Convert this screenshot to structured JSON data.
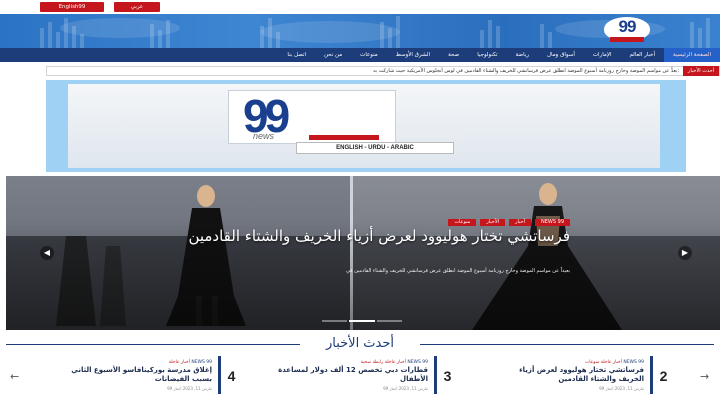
{
  "topbar": {
    "site_button": "English99",
    "lang_button": "عربي"
  },
  "brand": {
    "logo_text": "99"
  },
  "nav": {
    "items": [
      "الصفحة الرئيسية",
      "أخبار العالم",
      "الإمارات",
      "أسواق ومال",
      "رياضة",
      "تكنولوجيا",
      "صحة",
      "الشرق الأوسط",
      "منوعات",
      "من نحن",
      "اتصل بنا"
    ]
  },
  "ticker": {
    "label": "أحدث الأخبار",
    "text": "يعدُّ عن مواسم الموضة وحارج روزنامة أسبوع الموضة انطلق عرض فرساتشي للخريف والشتاء القادمين في لوس أنجلوس الأمريكية حيث شاركت به:"
  },
  "ad": {
    "logo": "99",
    "logo_sub": "news",
    "languages": "ENGLISH - URDU - ARABIC"
  },
  "hero": {
    "categories": [
      "NEWS 99",
      "أخبار",
      "الأخبار",
      "منوعات"
    ],
    "title": "فرساتشي تختار هوليوود لعرض أزياء الخريف والشتاء القادمين",
    "excerpt": "بعيداً عن مواسم الموضة وخارج روزنامة أسبوع الموضة انطلق عرض فرساتشي للخريف والشتاء القادمين في"
  },
  "latest": {
    "heading": "أحدث الأخبار",
    "items": [
      {
        "num": "2",
        "meta_source": "NEWS 99",
        "meta_cats": "أخبار عاجلة منوعات",
        "title": "فرساتشي تختار هوليوود لعرض أزياء الخريف والشتاء القادمين",
        "date": "مارس 11, 2023 أخبار 99"
      },
      {
        "num": "3",
        "meta_source": "NEWS 99",
        "meta_cats": "أخبار عاجلة رابطة صحية",
        "title": "قطارات دبي تخصص 12 ألف دولار لمساعدة الأطفال",
        "date": "مارس 11, 2023 أخبار 99"
      },
      {
        "num": "4",
        "meta_source": "NEWS 99",
        "meta_cats": "أخبار عاجلة",
        "title": "إغلاق مدرسة بوركينافاسو الأسبوع الثاني بسبب الفيضانات",
        "date": "مارس 11, 2023 أخبار 99"
      }
    ]
  },
  "colors": {
    "brand_blue": "#1c3d7a",
    "accent_red": "#c4161c",
    "header_blue": "#2b73c4",
    "ad_bg": "#9ed1f4"
  }
}
